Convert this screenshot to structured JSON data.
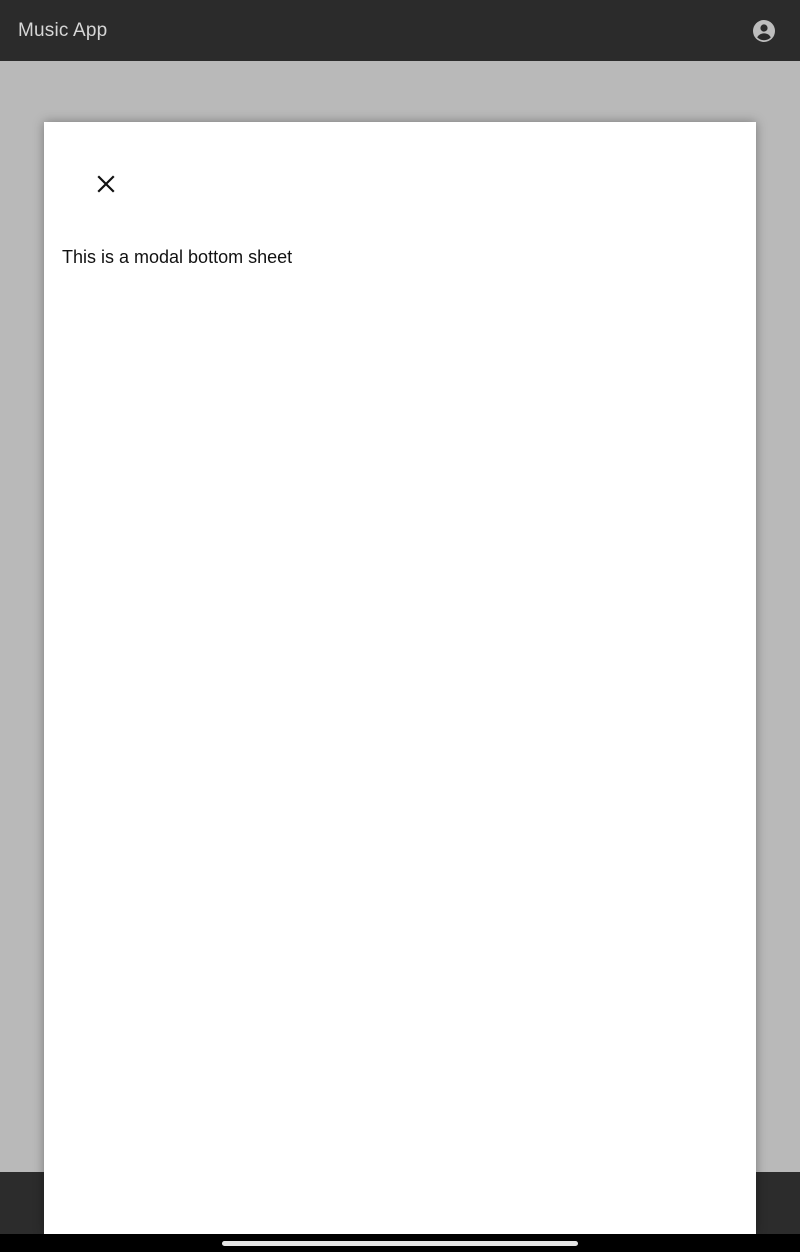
{
  "app_bar": {
    "title": "Music App",
    "account_icon": "account-circle-icon"
  },
  "bottom_sheet": {
    "close_icon": "close-icon",
    "message": "This is a modal bottom sheet"
  },
  "system_nav": {
    "handle_icon": "gesture-handle"
  },
  "colors": {
    "app_bar": "#2b2b2b",
    "scrim": "#b9b9b9",
    "sheet": "#ffffff",
    "text": "#111111"
  }
}
